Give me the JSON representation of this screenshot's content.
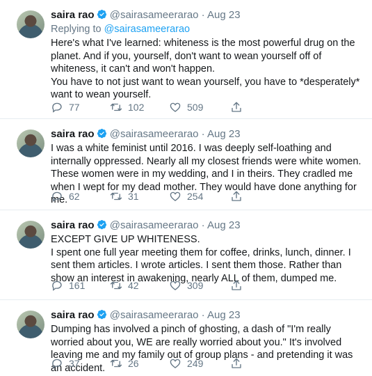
{
  "colors": {
    "accent": "#1da1f2",
    "muted": "#657786",
    "text": "#14171a"
  },
  "replying": {
    "prefix": "Replying to",
    "handle": "@sairasameerarao"
  },
  "tweets": [
    {
      "name": "saira rao",
      "handle": "@sairasameerarao",
      "separator": "·",
      "time": "Aug 23",
      "lines": [
        "Here's what I've learned: whiteness is the most powerful drug on the planet. And if you, yourself, don't want to wean yourself off of whiteness, it can't and won't happen.",
        "You have to not just want to wean yourself, you have to *desperately* want to wean yourself."
      ],
      "replies": "77",
      "retweets": "102",
      "likes": "509"
    },
    {
      "name": "saira rao",
      "handle": "@sairasameerarao",
      "separator": "·",
      "time": "Aug 23",
      "lines": [
        "I was a white feminist until 2016. I was deeply self-loathing and internally oppressed. Nearly all my closest friends were white women. These women were in my wedding, and I in theirs. They cradled me when I wept for my dead mother. They would have done anything for me."
      ],
      "replies": "62",
      "retweets": "31",
      "likes": "254"
    },
    {
      "name": "saira rao",
      "handle": "@sairasameerarao",
      "separator": "·",
      "time": "Aug 23",
      "lines": [
        "EXCEPT GIVE UP WHITENESS.",
        "I spent one full year meeting them for coffee, drinks, lunch, dinner. I sent them articles. I wrote articles. I sent them those. Rather than show an interest in awakening, nearly ALL of them, dumped me."
      ],
      "replies": "161",
      "retweets": "42",
      "likes": "309"
    },
    {
      "name": "saira rao",
      "handle": "@sairasameerarao",
      "separator": "·",
      "time": "Aug 23",
      "lines": [
        "Dumping has involved a pinch of ghosting, a dash of \"I'm really worried about you, WE are really worried about you.\" It's involved leaving me and my family out of group plans - and pretending it was an accident."
      ],
      "replies": "37",
      "retweets": "26",
      "likes": "249"
    }
  ]
}
